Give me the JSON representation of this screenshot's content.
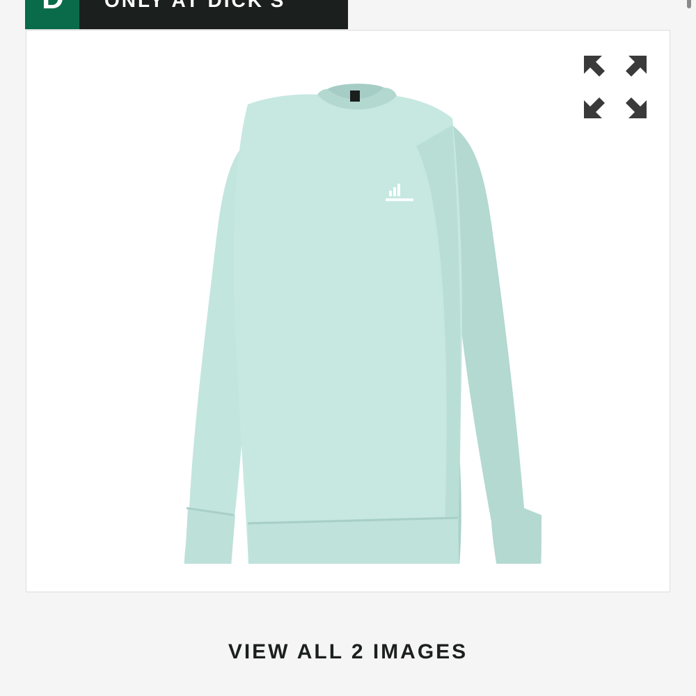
{
  "banner": {
    "logo_letter": "D",
    "text": "ONLY AT DICK'S",
    "colors": {
      "logo_bg": "#0a6b4b",
      "bar_bg": "#1b1f1e"
    }
  },
  "product": {
    "image_icon": "sweatshirt-image",
    "brand_mark": "adidas",
    "garment_color": "#bfe3dc"
  },
  "gallery": {
    "expand_icon": "expand-arrows-icon",
    "view_all_label": "VIEW ALL 2 IMAGES"
  }
}
